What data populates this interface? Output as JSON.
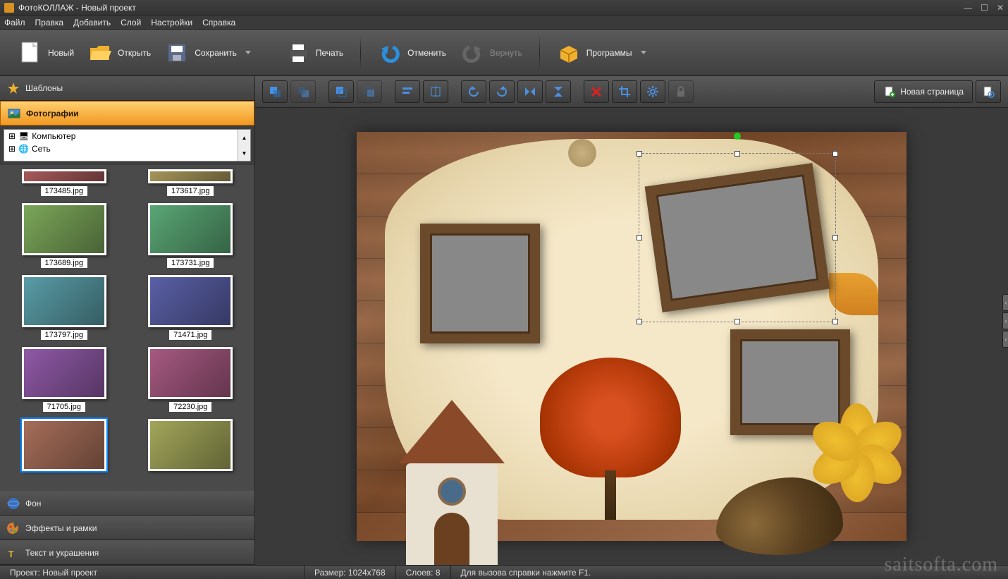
{
  "title": "ФотоКОЛЛАЖ - Новый проект",
  "menu": [
    "Файл",
    "Правка",
    "Добавить",
    "Слой",
    "Настройки",
    "Справка"
  ],
  "toolbar": {
    "new": "Новый",
    "open": "Открыть",
    "save": "Сохранить",
    "print": "Печать",
    "undo": "Отменить",
    "redo": "Вернуть",
    "programs": "Программы"
  },
  "sidebar": {
    "templates": "Шаблоны",
    "photos": "Фотографии",
    "tree": {
      "computer": "Компьютер",
      "network": "Сеть"
    },
    "background": "Фон",
    "effects": "Эффекты и рамки",
    "text": "Текст и украшения"
  },
  "thumbs": [
    {
      "name": "173485.jpg",
      "sel": false,
      "cut": true
    },
    {
      "name": "173617.jpg",
      "sel": false,
      "cut": true
    },
    {
      "name": "173689.jpg",
      "sel": false
    },
    {
      "name": "173731.jpg",
      "sel": false
    },
    {
      "name": "173797.jpg",
      "sel": false
    },
    {
      "name": "71471.jpg",
      "sel": false
    },
    {
      "name": "71705.jpg",
      "sel": false
    },
    {
      "name": "72230.jpg",
      "sel": false
    },
    {
      "name": "",
      "sel": true
    },
    {
      "name": "",
      "sel": false
    }
  ],
  "canvasbar": {
    "newpage": "Новая страница"
  },
  "status": {
    "project_lbl": "Проект:",
    "project": "Новый проект",
    "size_lbl": "Размер:",
    "size": "1024x768",
    "layers_lbl": "Слоев:",
    "layers": "8",
    "help": "Для вызова справки нажмите F1."
  },
  "watermark": "saitsofta.com"
}
